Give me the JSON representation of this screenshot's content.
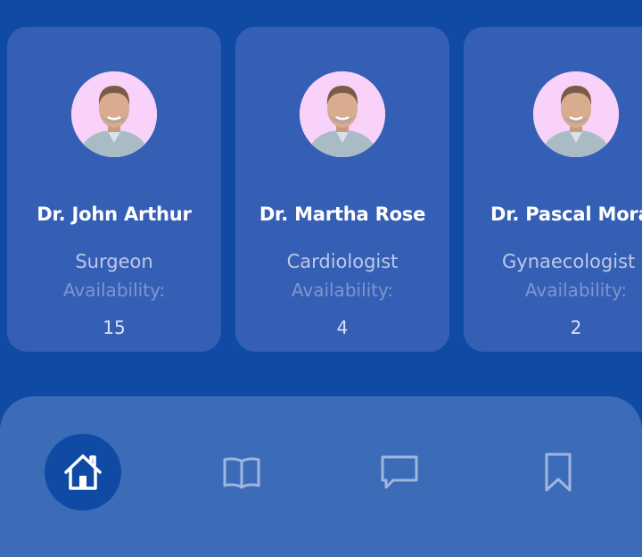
{
  "doctors": [
    {
      "name": "Dr. John Arthur",
      "specialty": "Surgeon",
      "availability_label": "Availability:",
      "availability": "15"
    },
    {
      "name": "Dr. Martha Rose",
      "specialty": "Cardiologist",
      "availability_label": "Availability:",
      "availability": "4"
    },
    {
      "name": "Dr. Pascal Mora",
      "specialty": "Gynaecologist",
      "availability_label": "Availability:",
      "availability": "2"
    }
  ],
  "bottom_nav": {
    "items": [
      {
        "icon": "home-icon",
        "active": true
      },
      {
        "icon": "book-icon",
        "active": false
      },
      {
        "icon": "chat-icon",
        "active": false
      },
      {
        "icon": "bookmark-icon",
        "active": false
      }
    ]
  },
  "colors": {
    "background": "#0f4aa4",
    "card": "#355fb5",
    "nav_bar": "#3c6cb8",
    "nav_active": "#0f4aa4",
    "avatar_bg": "#f8d2f8"
  }
}
